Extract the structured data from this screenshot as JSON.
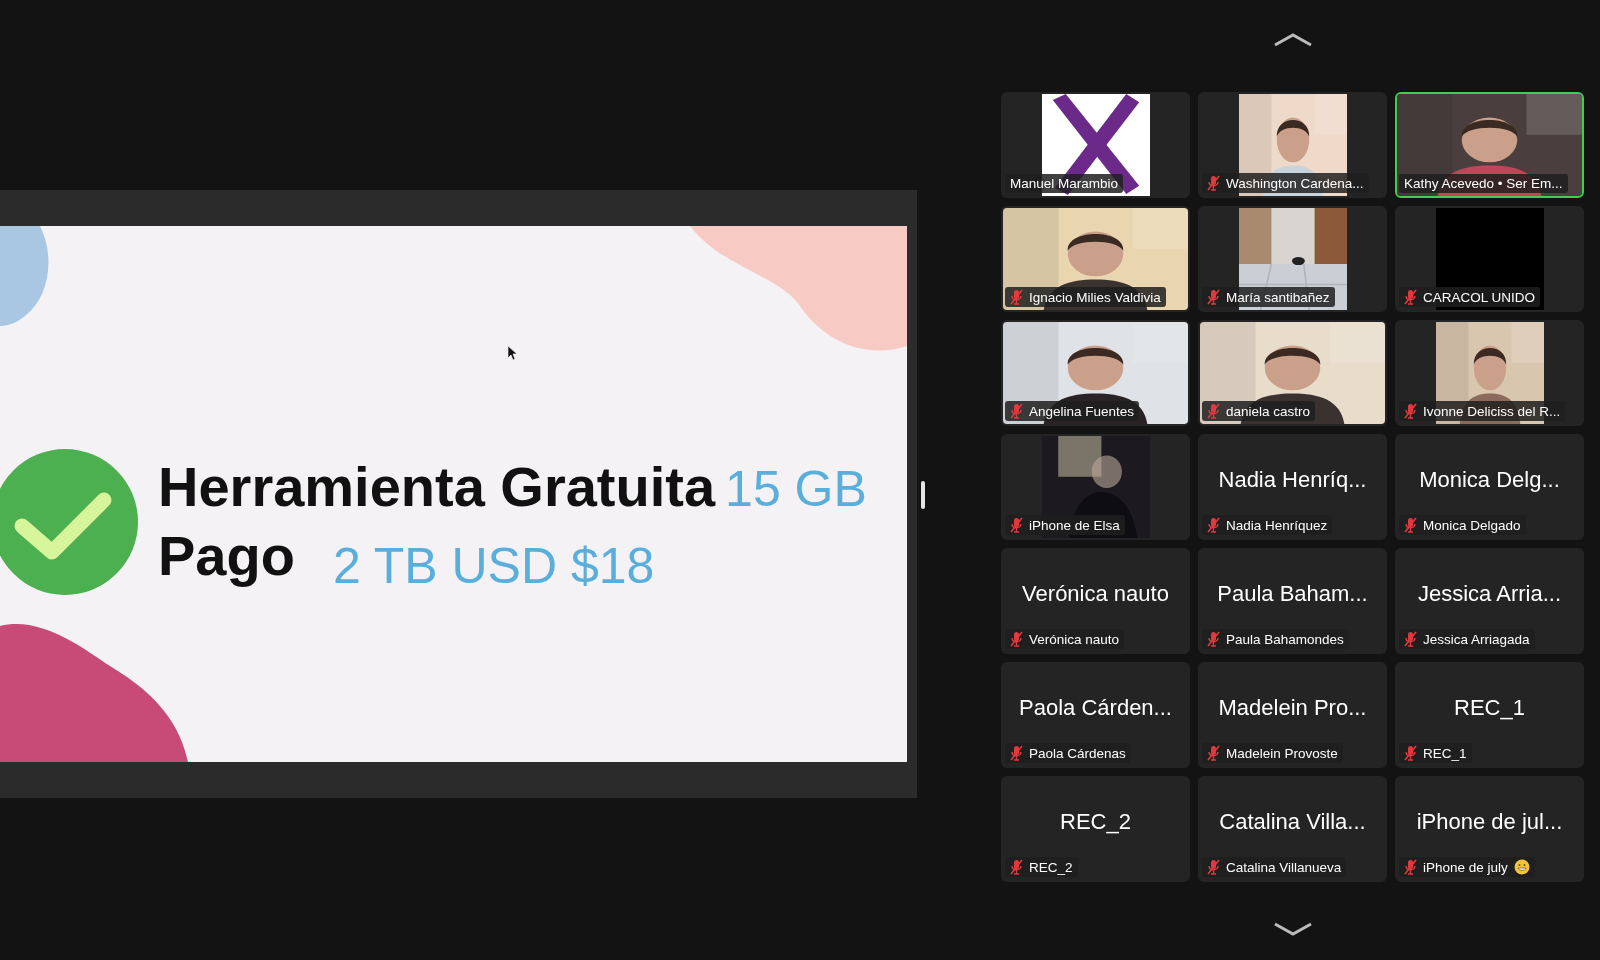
{
  "slide": {
    "title": "Herramienta Gratuita",
    "title_value": "15 GB",
    "subtitle": "Pago",
    "subtitle_value": "2 TB USD $18"
  },
  "participants": [
    {
      "kind": "portrait",
      "label": "Manuel Marambio",
      "muted": false,
      "speaking": false
    },
    {
      "kind": "portrait",
      "label": "Washington Cardena...",
      "muted": true,
      "speaking": false
    },
    {
      "kind": "video",
      "label": "Kathy Acevedo • Ser Em...",
      "muted": false,
      "speaking": true
    },
    {
      "kind": "video",
      "label": "Ignacio Milies Valdivia",
      "muted": true,
      "speaking": false
    },
    {
      "kind": "portrait",
      "label": "María santibañez",
      "muted": true,
      "speaking": false
    },
    {
      "kind": "portrait",
      "label": "CARACOL UNIDO",
      "muted": true,
      "speaking": false
    },
    {
      "kind": "video",
      "label": "Angelina Fuentes",
      "muted": true,
      "speaking": false
    },
    {
      "kind": "video",
      "label": "daniela castro",
      "muted": true,
      "speaking": false
    },
    {
      "kind": "portrait",
      "label": "Ivonne Deliciss del R...",
      "muted": true,
      "speaking": false
    },
    {
      "kind": "portrait",
      "label": "iPhone de Elsa",
      "muted": true,
      "speaking": false
    },
    {
      "kind": "name",
      "tile_name": "Nadia Henríq...",
      "label": "Nadia Henríquez",
      "muted": true,
      "speaking": false
    },
    {
      "kind": "name",
      "tile_name": "Monica Delg...",
      "label": "Monica Delgado",
      "muted": true,
      "speaking": false
    },
    {
      "kind": "name",
      "tile_name": "Verónica nauto",
      "label": "Verónica nauto",
      "muted": true,
      "speaking": false
    },
    {
      "kind": "name",
      "tile_name": "Paula Baham...",
      "label": "Paula Bahamondes",
      "muted": true,
      "speaking": false
    },
    {
      "kind": "name",
      "tile_name": "Jessica Arria...",
      "label": "Jessica Arriagada",
      "muted": true,
      "speaking": false
    },
    {
      "kind": "name",
      "tile_name": "Paola Cárden...",
      "label": "Paola Cárdenas",
      "muted": true,
      "speaking": false
    },
    {
      "kind": "name",
      "tile_name": "Madelein Pro...",
      "label": "Madelein Provoste",
      "muted": true,
      "speaking": false
    },
    {
      "kind": "name",
      "tile_name": "REC_1",
      "label": "REC_1",
      "muted": true,
      "speaking": false
    },
    {
      "kind": "name",
      "tile_name": "REC_2",
      "label": "REC_2",
      "muted": true,
      "speaking": false
    },
    {
      "kind": "name",
      "tile_name": "Catalina Villa...",
      "label": "Catalina Villanueva",
      "muted": true,
      "speaking": false
    },
    {
      "kind": "name",
      "tile_name": "iPhone de jul...",
      "label": "iPhone de july",
      "muted": true,
      "speaking": false,
      "emoji_badge": true
    }
  ]
}
